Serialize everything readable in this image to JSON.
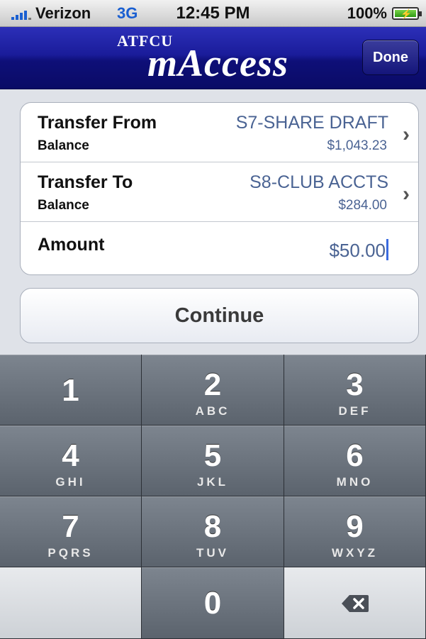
{
  "status_bar": {
    "carrier": "Verizon",
    "network": "3G",
    "time": "12:45 PM",
    "battery": "100%"
  },
  "nav_bar": {
    "brand_small": "ATFCU",
    "brand_big": "mAccess",
    "done_label": "Done",
    "brand_color": "#1a1c9a"
  },
  "form": {
    "transfer_from": {
      "label": "Transfer From",
      "sublabel": "Balance",
      "account": "S7-SHARE DRAFT",
      "balance": "$1,043.23"
    },
    "transfer_to": {
      "label": "Transfer To",
      "sublabel": "Balance",
      "account": "S8-CLUB ACCTS",
      "balance": "$284.00"
    },
    "amount": {
      "label": "Amount",
      "value": "$50.00"
    },
    "value_color": "#4a6393"
  },
  "continue_label": "Continue",
  "keypad": {
    "keys": [
      {
        "num": "1",
        "letters": ""
      },
      {
        "num": "2",
        "letters": "ABC"
      },
      {
        "num": "3",
        "letters": "DEF"
      },
      {
        "num": "4",
        "letters": "GHI"
      },
      {
        "num": "5",
        "letters": "JKL"
      },
      {
        "num": "6",
        "letters": "MNO"
      },
      {
        "num": "7",
        "letters": "PQRS"
      },
      {
        "num": "8",
        "letters": "TUV"
      },
      {
        "num": "9",
        "letters": "WXYZ"
      },
      {
        "num": "0",
        "letters": ""
      }
    ]
  }
}
